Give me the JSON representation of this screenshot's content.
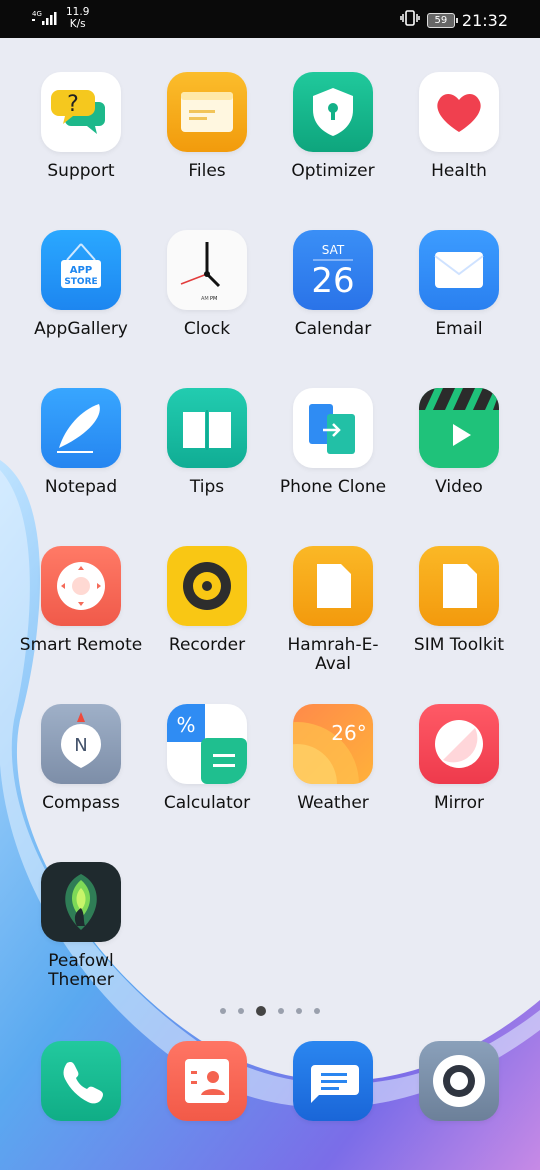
{
  "status_bar": {
    "network": "4G",
    "speed_value": "11.9",
    "speed_unit": "K/s",
    "battery": "59",
    "time": "21:32"
  },
  "apps": [
    {
      "name": "Support",
      "icon": "support-icon"
    },
    {
      "name": "Files",
      "icon": "files-icon"
    },
    {
      "name": "Optimizer",
      "icon": "optimizer-icon"
    },
    {
      "name": "Health",
      "icon": "health-icon"
    },
    {
      "name": "AppGallery",
      "icon": "appgallery-icon",
      "icon_text": "APP STORE"
    },
    {
      "name": "Clock",
      "icon": "clock-icon",
      "icon_text_am": "AM",
      "icon_text_pm": "PM"
    },
    {
      "name": "Calendar",
      "icon": "calendar-icon",
      "icon_text_day": "SAT",
      "icon_text_date": "26"
    },
    {
      "name": "Email",
      "icon": "email-icon"
    },
    {
      "name": "Notepad",
      "icon": "notepad-icon"
    },
    {
      "name": "Tips",
      "icon": "tips-icon"
    },
    {
      "name": "Phone Clone",
      "icon": "phone-clone-icon"
    },
    {
      "name": "Video",
      "icon": "video-icon"
    },
    {
      "name": "Smart Remote",
      "icon": "smart-remote-icon"
    },
    {
      "name": "Recorder",
      "icon": "recorder-icon"
    },
    {
      "name": "Hamrah-E-Aval",
      "icon": "hamrah-e-aval-icon"
    },
    {
      "name": "SIM Toolkit",
      "icon": "sim-toolkit-icon"
    },
    {
      "name": "Compass",
      "icon": "compass-icon",
      "icon_text": "N"
    },
    {
      "name": "Calculator",
      "icon": "calculator-icon",
      "icon_text": "%"
    },
    {
      "name": "Weather",
      "icon": "weather-icon",
      "icon_text": "26°"
    },
    {
      "name": "Mirror",
      "icon": "mirror-icon"
    },
    {
      "name": "Peafowl Themer",
      "icon": "peafowl-themer-icon"
    }
  ],
  "page_indicator": {
    "count": 6,
    "active": 2
  },
  "dock": [
    {
      "icon": "phone-icon"
    },
    {
      "icon": "contacts-icon"
    },
    {
      "icon": "messages-icon"
    },
    {
      "icon": "camera-icon"
    }
  ]
}
